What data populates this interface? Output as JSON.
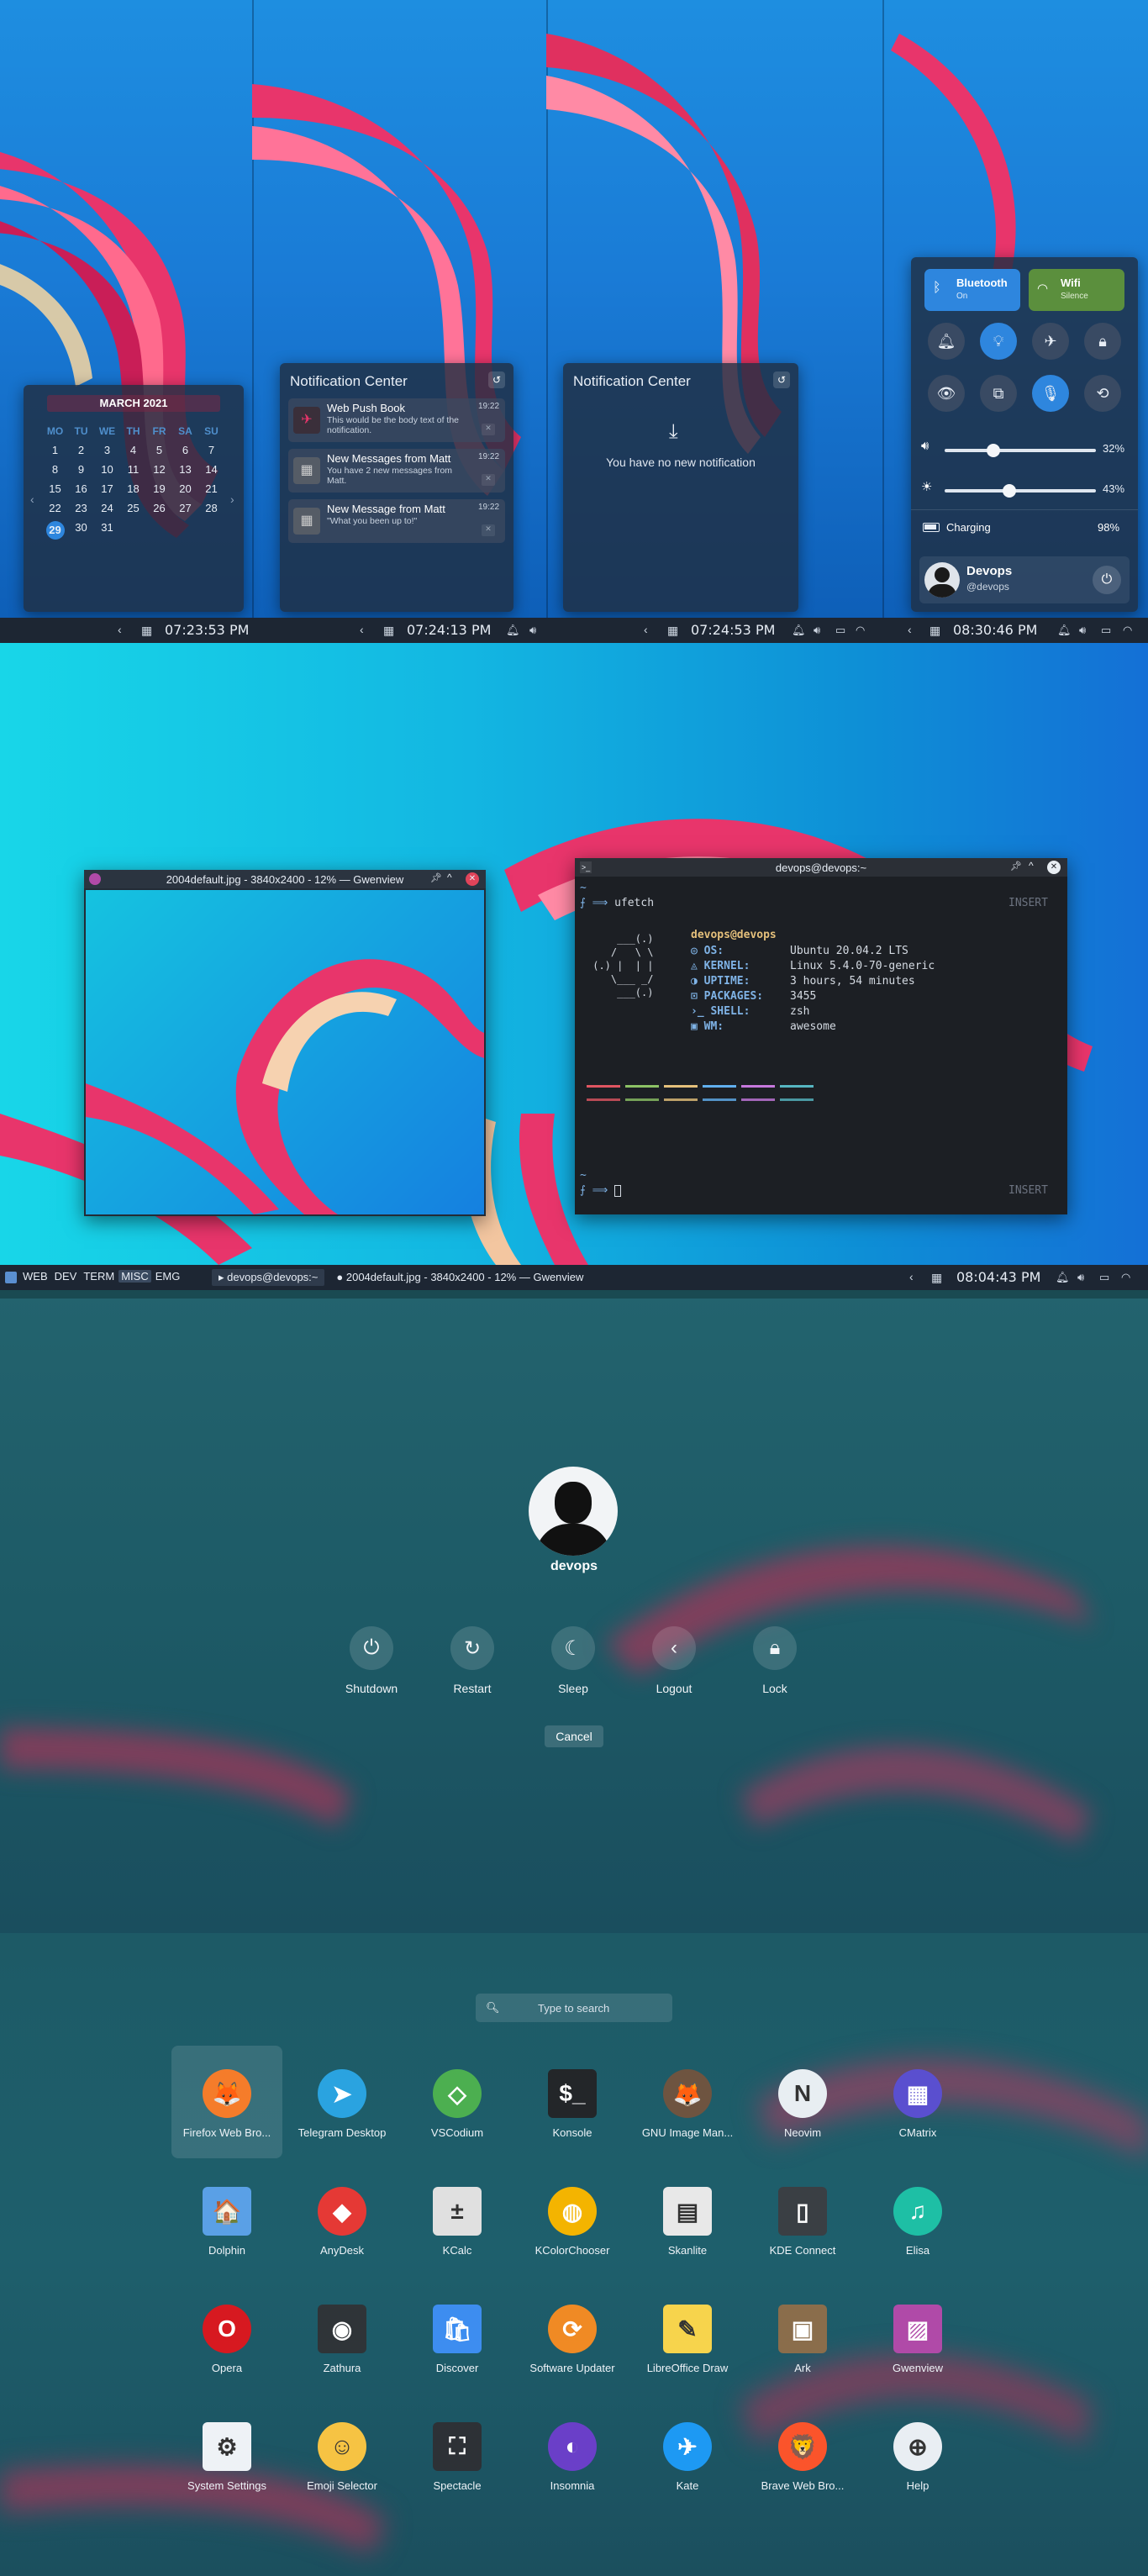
{
  "colors": {
    "accent": "#2e86de",
    "panel": "#202e42",
    "taskbar": "#1d2633"
  },
  "section1": {
    "taskbars": [
      {
        "time": "07:23:53 PM"
      },
      {
        "time": "07:24:13 PM"
      },
      {
        "time": "07:24:53 PM"
      },
      {
        "time": "08:30:46 PM"
      }
    ],
    "calendar": {
      "title": "MARCH 2021",
      "weekdays": [
        "MO",
        "TU",
        "WE",
        "TH",
        "FR",
        "SA",
        "SU"
      ],
      "weeks": [
        [
          "1",
          "2",
          "3",
          "4",
          "5",
          "6",
          "7"
        ],
        [
          "8",
          "9",
          "10",
          "11",
          "12",
          "13",
          "14"
        ],
        [
          "15",
          "16",
          "17",
          "18",
          "19",
          "20",
          "21"
        ],
        [
          "22",
          "23",
          "24",
          "25",
          "26",
          "27",
          "28"
        ],
        [
          "29",
          "30",
          "31",
          "",
          "",
          "",
          ""
        ]
      ],
      "today": "29"
    },
    "notification_center": {
      "title": "Notification Center",
      "items": [
        {
          "title": "Web Push Book",
          "body": "This would be the body text of the notification.",
          "time": "19:22",
          "icon": "book-icon"
        },
        {
          "title": "New Messages from Matt",
          "body": "You have 2 new messages from Matt.",
          "time": "19:22",
          "icon": "matt-avatar-icon"
        },
        {
          "title": "New Message from Matt",
          "body": "\"What you been up to!\"",
          "time": "19:22",
          "icon": "matt-avatar-icon"
        }
      ]
    },
    "notification_empty": {
      "title": "Notification Center",
      "message": "You have no new notification"
    },
    "quick_settings": {
      "bluetooth": {
        "label": "Bluetooth",
        "state": "On"
      },
      "wifi": {
        "label": "Wifi",
        "state": "Silence"
      },
      "volume_percent": "32%",
      "volume_level": 0.32,
      "brightness_percent": "43%",
      "brightness_level": 0.43,
      "battery_label": "Charging",
      "battery_percent": "98%",
      "user_name": "Devops",
      "user_handle": "@devops"
    }
  },
  "section2": {
    "taskbar": {
      "workspaces": [
        "WEB",
        "DEV",
        "TERM",
        "MISC",
        "EMG"
      ],
      "active_workspace": "MISC",
      "tasks": [
        "devops@devops:~",
        "2004default.jpg - 3840x2400 - 12% — Gwenview"
      ],
      "time": "08:04:43 PM"
    },
    "gwenview": {
      "title": "2004default.jpg - 3840x2400 - 12% — Gwenview"
    },
    "terminal": {
      "title": "devops@devops:~",
      "prompt_cmd": "ufetch",
      "mode": "INSERT",
      "host": "devops@devops",
      "info": [
        {
          "key": "OS:",
          "value": "Ubuntu 20.04.2 LTS"
        },
        {
          "key": "KERNEL:",
          "value": "Linux 5.4.0-70-generic"
        },
        {
          "key": "UPTIME:",
          "value": "3 hours, 54 minutes"
        },
        {
          "key": "PACKAGES:",
          "value": "3455"
        },
        {
          "key": "SHELL:",
          "value": "zsh"
        },
        {
          "key": "WM:",
          "value": "awesome"
        }
      ],
      "palette": [
        "#e05561",
        "#8cc265",
        "#e5c07b",
        "#61afef",
        "#c678dd",
        "#56b6c2"
      ]
    }
  },
  "section3": {
    "username": "devops",
    "actions": [
      {
        "label": "Shutdown",
        "icon": "power-icon"
      },
      {
        "label": "Restart",
        "icon": "restart-icon"
      },
      {
        "label": "Sleep",
        "icon": "sleep-icon"
      },
      {
        "label": "Logout",
        "icon": "logout-icon"
      },
      {
        "label": "Lock",
        "icon": "lock-icon"
      }
    ],
    "cancel": "Cancel"
  },
  "section4": {
    "search_placeholder": "Type to search",
    "apps": [
      {
        "name": "Firefox Web Bro...",
        "icon": "firefox-icon",
        "color": "#f57c2a",
        "glyph": "🦊"
      },
      {
        "name": "Telegram Desktop",
        "icon": "telegram-icon",
        "color": "#2aa3e0",
        "glyph": "➤"
      },
      {
        "name": "VSCodium",
        "icon": "vscodium-icon",
        "color": "#4caf50",
        "glyph": "◇"
      },
      {
        "name": "Konsole",
        "icon": "konsole-icon",
        "color": "#232629",
        "glyph": "$_"
      },
      {
        "name": "GNU Image Man...",
        "icon": "gimp-icon",
        "color": "#6e5440",
        "glyph": "🦊"
      },
      {
        "name": "Neovim",
        "icon": "neovim-icon",
        "color": "#e8eef2",
        "glyph": "N"
      },
      {
        "name": "CMatrix",
        "icon": "cmatrix-icon",
        "color": "#5a4fcf",
        "glyph": "▦"
      },
      {
        "name": "Dolphin",
        "icon": "dolphin-icon",
        "color": "#5aa0e6",
        "glyph": "🏠"
      },
      {
        "name": "AnyDesk",
        "icon": "anydesk-icon",
        "color": "#e53935",
        "glyph": "◆"
      },
      {
        "name": "KCalc",
        "icon": "kcalc-icon",
        "color": "#e0e0e0",
        "glyph": "±"
      },
      {
        "name": "KColorChooser",
        "icon": "kcolorchooser-icon",
        "color": "#f4b400",
        "glyph": "◍"
      },
      {
        "name": "Skanlite",
        "icon": "skanlite-icon",
        "color": "#e8e8e8",
        "glyph": "▤"
      },
      {
        "name": "KDE Connect",
        "icon": "kdeconnect-icon",
        "color": "#3a3f44",
        "glyph": "▯"
      },
      {
        "name": "Elisa",
        "icon": "elisa-icon",
        "color": "#1ebfa5",
        "glyph": "♫"
      },
      {
        "name": "Opera",
        "icon": "opera-icon",
        "color": "#d71920",
        "glyph": "O"
      },
      {
        "name": "Zathura",
        "icon": "zathura-icon",
        "color": "#2f3438",
        "glyph": "◉"
      },
      {
        "name": "Discover",
        "icon": "discover-icon",
        "color": "#3d8df0",
        "glyph": "🛍"
      },
      {
        "name": "Software Updater",
        "icon": "software-updater-icon",
        "color": "#f08a24",
        "glyph": "⟳"
      },
      {
        "name": "LibreOffice Draw",
        "icon": "libreoffice-draw-icon",
        "color": "#f7d44c",
        "glyph": "✎"
      },
      {
        "name": "Ark",
        "icon": "ark-icon",
        "color": "#8a6d4b",
        "glyph": "▣"
      },
      {
        "name": "Gwenview",
        "icon": "gwenview-icon",
        "color": "#b04aa8",
        "glyph": "▨"
      },
      {
        "name": "System Settings",
        "icon": "system-settings-icon",
        "color": "#eef2f6",
        "glyph": "⚙"
      },
      {
        "name": "Emoji Selector",
        "icon": "emoji-selector-icon",
        "color": "#f6c343",
        "glyph": "☺"
      },
      {
        "name": "Spectacle",
        "icon": "spectacle-icon",
        "color": "#2d3136",
        "glyph": "⛶"
      },
      {
        "name": "Insomnia",
        "icon": "insomnia-icon",
        "color": "#6a3fc8",
        "glyph": "◐"
      },
      {
        "name": "Kate",
        "icon": "kate-icon",
        "color": "#1d99f3",
        "glyph": "✈"
      },
      {
        "name": "Brave Web Bro...",
        "icon": "brave-icon",
        "color": "#fb542b",
        "glyph": "🦁"
      },
      {
        "name": "Help",
        "icon": "help-icon",
        "color": "#e9eef3",
        "glyph": "⊕"
      }
    ]
  }
}
